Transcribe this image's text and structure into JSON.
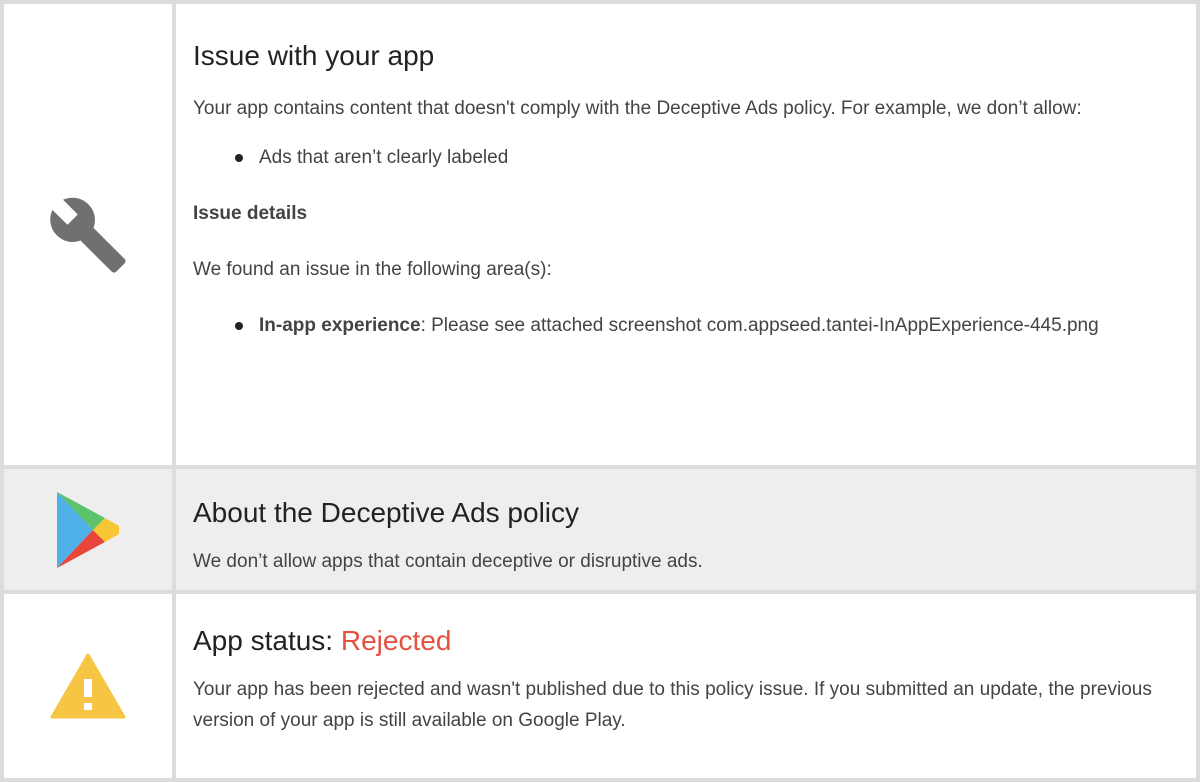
{
  "issue": {
    "title": "Issue with your app",
    "intro": "Your app contains content that doesn't comply with the Deceptive Ads policy. For example, we don’t allow:",
    "examples": [
      "Ads that aren’t clearly labeled"
    ],
    "details_heading": "Issue details",
    "found_text": "We found an issue in the following area(s):",
    "areas": [
      {
        "label": "In-app experience",
        "text": ": Please see attached screenshot com.appseed.tantei-InAppExperience-445.png"
      }
    ],
    "icon": "wrench-icon"
  },
  "policy": {
    "title": "About the Deceptive Ads policy",
    "description": "We don’t allow apps that contain deceptive or disruptive ads.",
    "icon": "google-play-icon"
  },
  "status": {
    "label": "App status: ",
    "value": "Rejected",
    "description": "Your app has been rejected and wasn't published due to this policy issue. If you submitted an update, the previous version of your app is still available on Google Play.",
    "icon": "warning-icon",
    "value_color": "#e2523f"
  }
}
